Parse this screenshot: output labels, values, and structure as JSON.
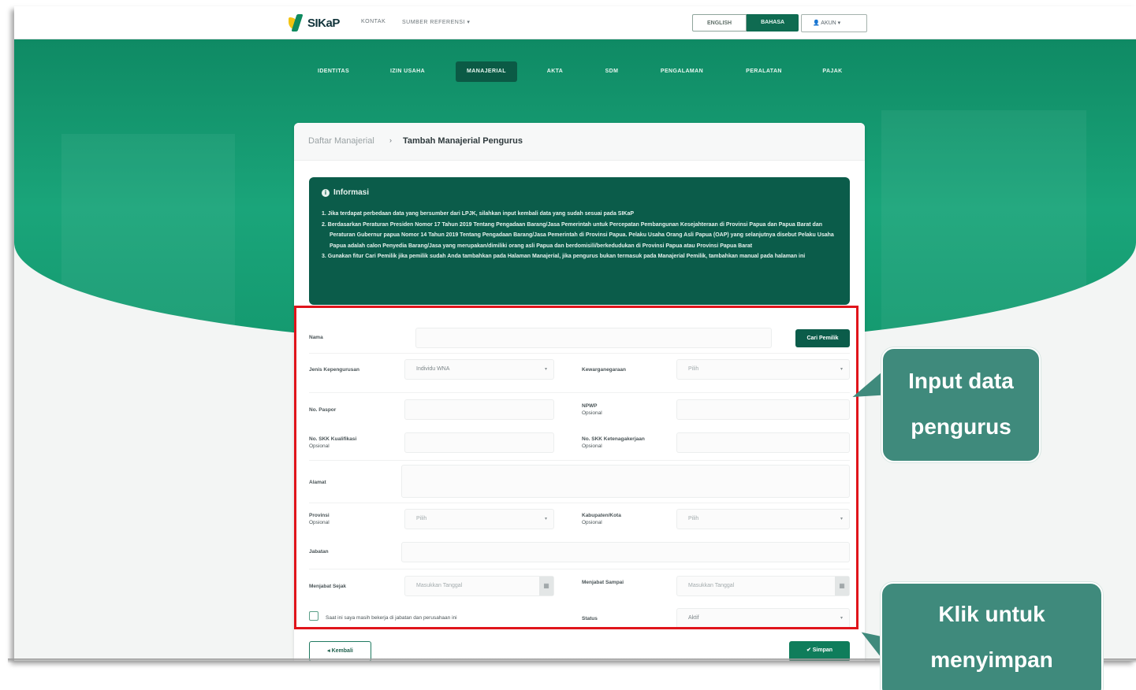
{
  "app": {
    "logo_text": "SIKaP",
    "top_links": [
      "KONTAK",
      "SUMBER REFERENSI ▾"
    ],
    "lang_en": "ENGLISH",
    "lang_id": "BAHASA",
    "user_label": "AKUN ▾"
  },
  "menu": [
    "IDENTITAS",
    "IZIN USAHA",
    "MANAJERIAL",
    "AKTA",
    "SDM",
    "PENGALAMAN",
    "PERALATAN",
    "PAJAK"
  ],
  "menu_active": "MANAJERIAL",
  "breadcrumb": {
    "parent": "Daftar Manajerial",
    "separator": "›",
    "current": "Tambah Manajerial Pengurus"
  },
  "info": {
    "title": "Informasi",
    "items": [
      "1. Jika terdapat perbedaan data yang bersumber dari LPJK, silahkan input kembali data yang sudah sesuai pada SIKaP",
      "2. Berdasarkan Peraturan Presiden Nomor 17 Tahun 2019 Tentang Pengadaan Barang/Jasa Pemerintah untuk Percepatan Pembangunan Kesejahteraan di Provinsi Papua dan Papua Barat dan Peraturan Gubernur papua Nomor 14 Tahun 2019 Tentang Pengadaan Barang/Jasa Pemerintah di Provinsi Papua. Pelaku Usaha Orang Asli Papua (OAP) yang selanjutnya disebut Pelaku Usaha Papua adalah calon Penyedia Barang/Jasa yang merupakan/dimiliki orang asli Papua dan berdomisili/berkedudukan di Provinsi Papua atau Provinsi Papua Barat",
      "3. Gunakan fitur Cari Pemilik jika pemilik sudah Anda tambahkan pada Halaman Manajerial, jika pengurus bukan termasuk pada Manajerial Pemilik, tambahkan manual pada halaman ini"
    ]
  },
  "form": {
    "nama_label": "Nama",
    "cari_pemilik": "Cari Pemilik",
    "jenis_kep_label": "Jenis Kepengurusan",
    "jenis_kep_value": "Individu WNA",
    "kewarganegaraan_label": "Kewarganegaraan",
    "kewarganegaraan_value": "Pilih",
    "paspor_label": "No. Paspor",
    "npwp_label": "NPWP",
    "npwp_opt": "Opsional",
    "skk_kualifikasi_label": "No. SKK Kualifikasi",
    "skk_kualifikasi_opt": "Opsional",
    "skk_ketenagakerjaan_label": "No. SKK Ketenagakerjaan",
    "skk_ketenagakerjaan_opt": "Opsional",
    "alamat_label": "Alamat",
    "provinsi_label": "Provinsi",
    "provinsi_opt": "Opsional",
    "provinsi_value": "Pilih",
    "kabkota_label": "Kabupaten/Kota",
    "kabkota_opt": "Opsional",
    "kabkota_value": "Pilih",
    "jabatan_label": "Jabatan",
    "menjabat_sejak_label": "Menjabat Sejak",
    "menjabat_sejak_placeholder": "Masukkan Tanggal",
    "menjabat_sampai_label": "Menjabat Sampai",
    "menjabat_sampai_placeholder": "Masukkan Tanggal",
    "checkbox_label": "Saat ini saya masih bekerja di jabatan dan perusahaan ini",
    "status_label": "Status",
    "status_value": "Aktif"
  },
  "buttons": {
    "kembali": "◂  Kembali",
    "simpan": "✔  Simpan"
  },
  "callouts": {
    "input_line1": "Input data",
    "input_line2": "pengurus",
    "klik_line1": "Klik untuk",
    "klik_line2": "menyimpan"
  },
  "colors": {
    "brand_green": "#0b5c4a",
    "hero_green": "#14996f",
    "highlight_red": "#e0141b",
    "callout_teal": "#3f8a7c"
  }
}
